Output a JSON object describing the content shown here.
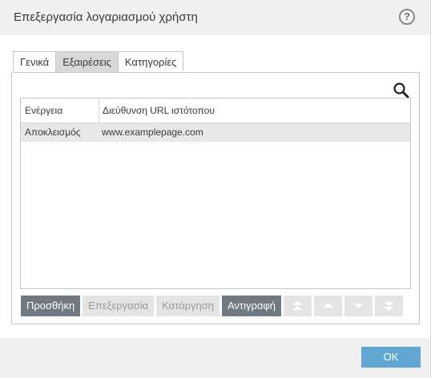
{
  "dialog": {
    "title": "Επεξεργασία λογαριασμού χρήστη",
    "help_label": "?"
  },
  "tabs": [
    {
      "label": "Γενικά",
      "active": false
    },
    {
      "label": "Εξαιρέσεις",
      "active": true
    },
    {
      "label": "Κατηγορίες",
      "active": false
    }
  ],
  "table": {
    "columns": [
      "Ενέργεια",
      "Διεύθυνση URL ιστότοπου"
    ],
    "rows": [
      {
        "action": "Αποκλεισμός",
        "url": "www.examplepage.com"
      }
    ]
  },
  "buttons": {
    "add": "Προσθήκη",
    "edit": "Επεξεργασία",
    "remove": "Κατάργηση",
    "copy": "Αντιγραφή"
  },
  "footer": {
    "ok": "OK"
  },
  "colors": {
    "accent": "#60a7d4",
    "button_enabled": "#707a80",
    "button_disabled": "#e4e4e4"
  },
  "icons": [
    "help-icon",
    "search-icon",
    "move-top-icon",
    "move-up-icon",
    "move-down-icon",
    "move-bottom-icon"
  ]
}
